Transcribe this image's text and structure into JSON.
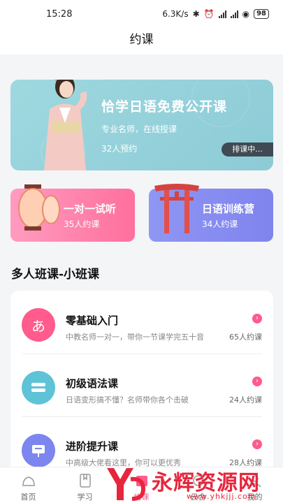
{
  "status": {
    "time": "15:28",
    "speed": "6.3K/s",
    "battery": "98"
  },
  "header": {
    "title": "约课"
  },
  "banner": {
    "title": "恰学日语免费公开课",
    "subtitle": "专业名师，在线授课",
    "count": "32人预约",
    "pill": "排课中..."
  },
  "cards": [
    {
      "title": "一对一试听",
      "count": "35人约课"
    },
    {
      "title": "日语训练营",
      "count": "34人约课"
    }
  ],
  "section": {
    "title": "多人班课-小班课"
  },
  "courses": [
    {
      "name": "零基础入门",
      "desc": "中教名师一对一，带你一节课学完五十音",
      "count": "65人约课",
      "avatar_char": "あ",
      "color": "#ff5b8d"
    },
    {
      "name": "初级语法课",
      "desc": "日语变形搞不懂？名师带你各个击破",
      "count": "24人约课",
      "color": "#5ec3d6"
    },
    {
      "name": "进阶提升课",
      "desc": "中高级大佬看这里，你可以更优秀",
      "count": "28人约课",
      "color": "#7c86ee"
    }
  ],
  "tabs": [
    "首页",
    "学习",
    "约课",
    "云合",
    "我的"
  ],
  "watermark": {
    "text": "永辉资源网",
    "url": "www.yhkjjj.com"
  }
}
